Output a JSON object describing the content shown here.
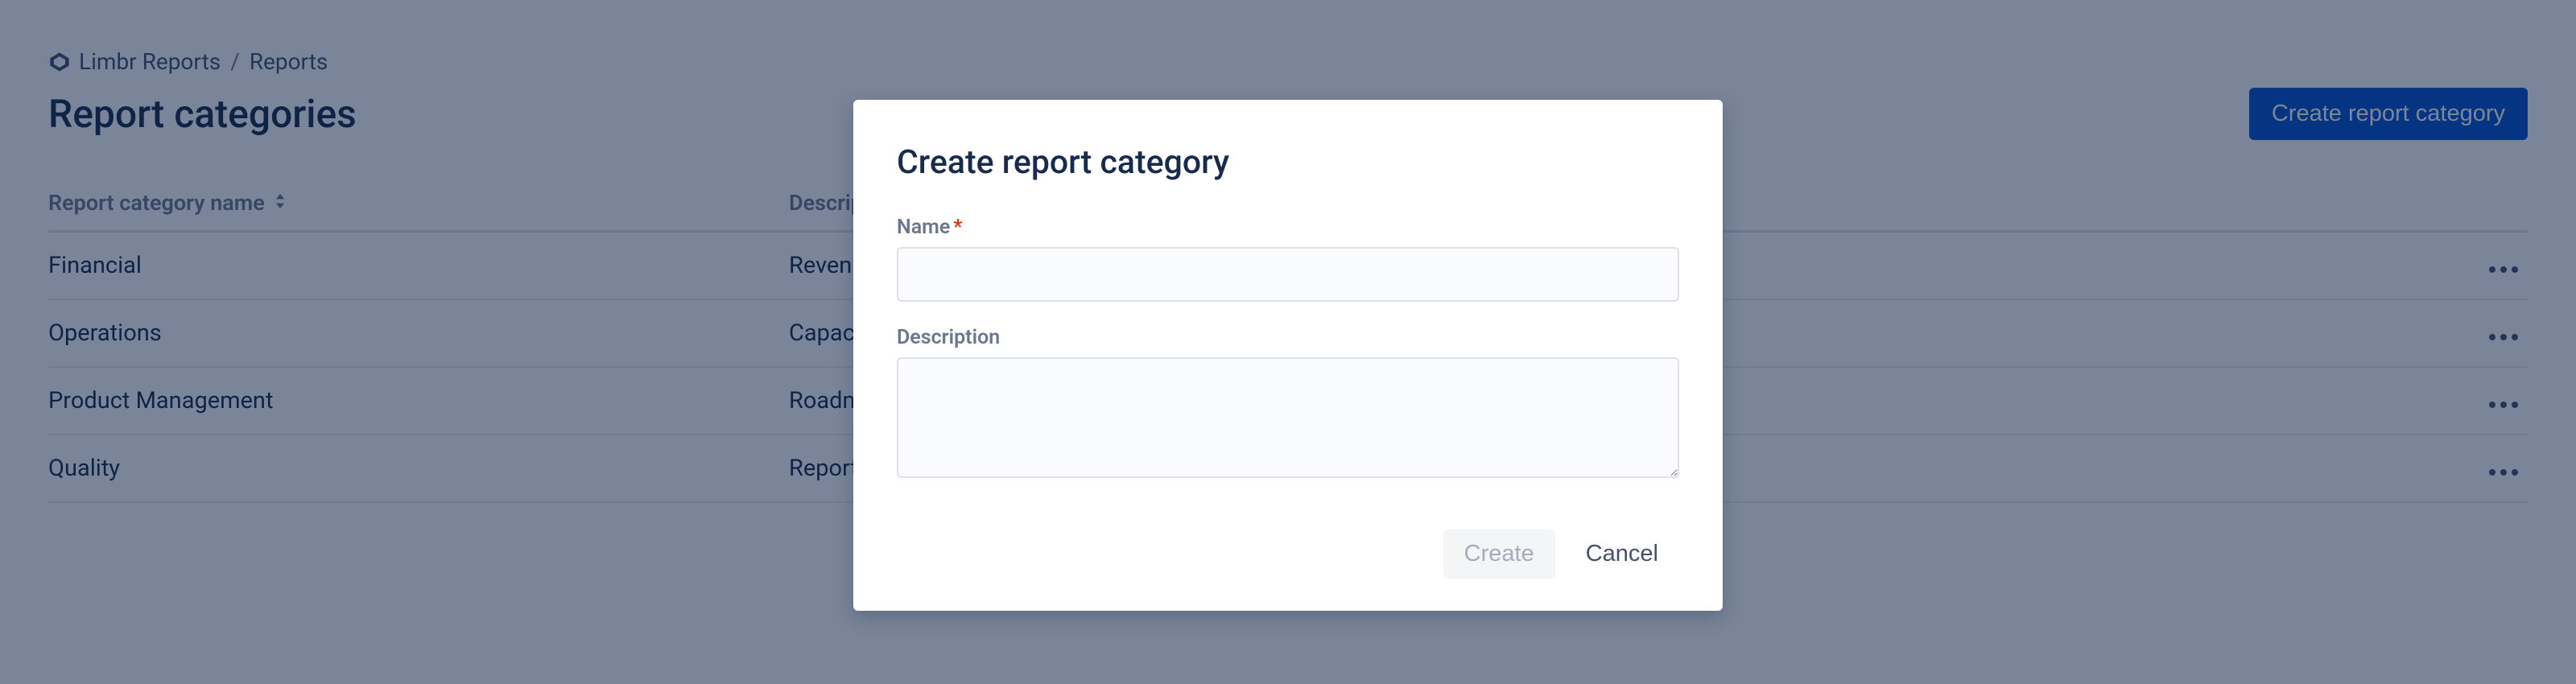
{
  "breadcrumb": {
    "app": "Limbr Reports",
    "section": "Reports"
  },
  "page": {
    "title": "Report categories",
    "create_button_label": "Create report category"
  },
  "table": {
    "columns": {
      "name": "Report category name",
      "description": "Description"
    },
    "rows": [
      {
        "name": "Financial",
        "description": "Revenue"
      },
      {
        "name": "Operations",
        "description": "Capacity"
      },
      {
        "name": "Product Management",
        "description": "Roadmap"
      },
      {
        "name": "Quality",
        "description": "Report"
      }
    ]
  },
  "dialog": {
    "title": "Create report category",
    "fields": {
      "name_label": "Name",
      "name_value": "",
      "description_label": "Description",
      "description_value": ""
    },
    "buttons": {
      "create": "Create",
      "cancel": "Cancel"
    }
  }
}
